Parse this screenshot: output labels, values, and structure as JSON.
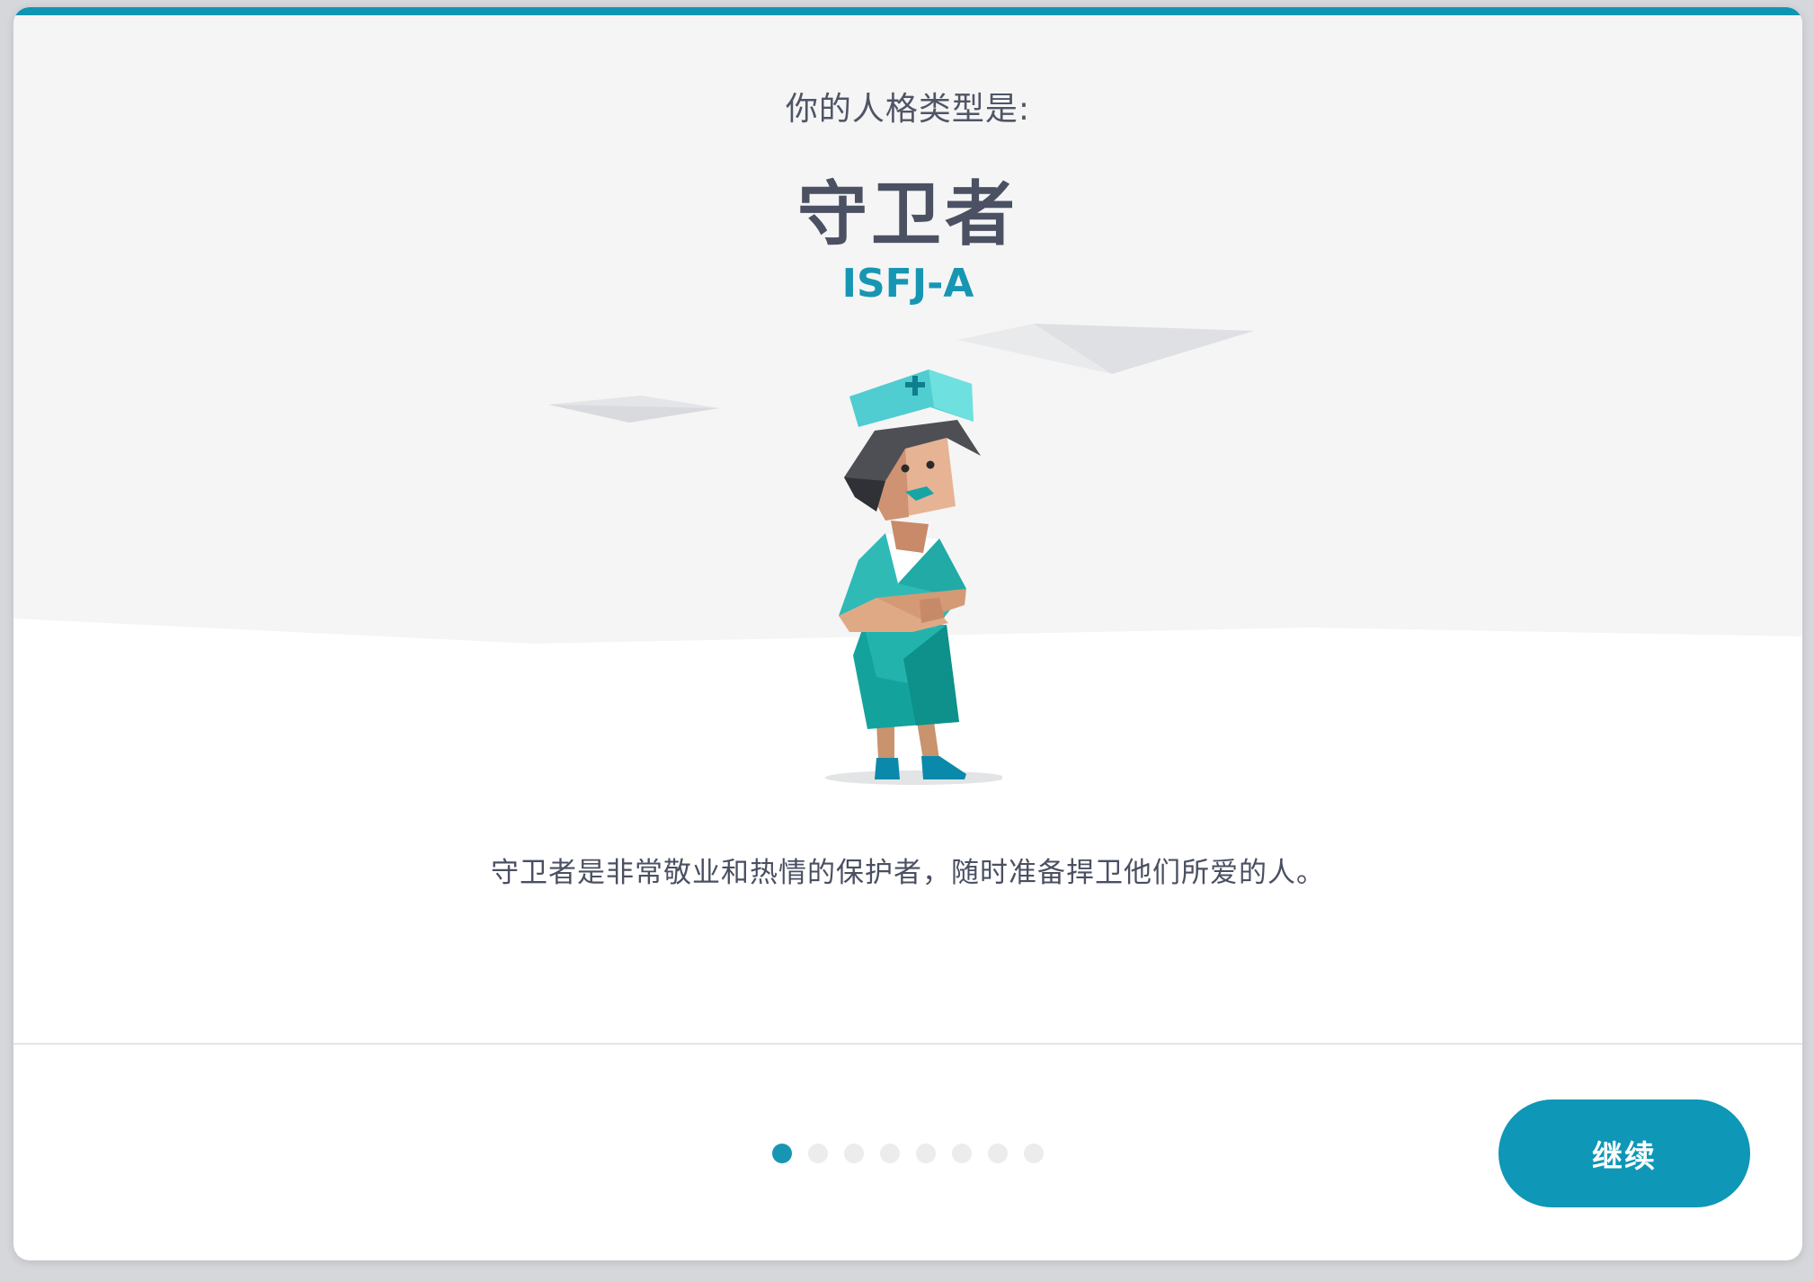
{
  "result": {
    "intro": "你的人格类型是:",
    "title": "守卫者",
    "code": "ISFJ-A",
    "description": "守卫者是非常敬业和热情的保护者，随时准备捍卫他们所爱的人。",
    "illustration_icon": "nurse-character-icon"
  },
  "pager": {
    "total": 8,
    "active_index": 0
  },
  "footer": {
    "continue_label": "继续"
  },
  "colors": {
    "accent": "#0e95b2",
    "title_text": "#4b5163",
    "hero_background": "#f5f5f5"
  }
}
